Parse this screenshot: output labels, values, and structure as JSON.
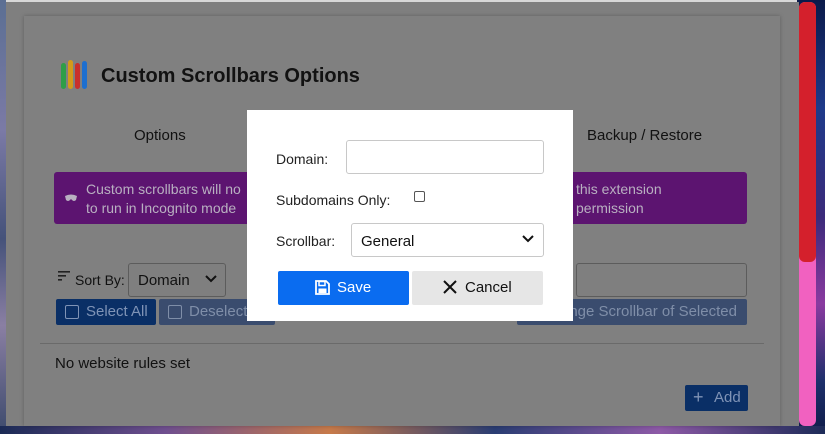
{
  "page": {
    "title": "Custom Scrollbars Options",
    "tabs": {
      "options": "Options",
      "backup": "Backup / Restore"
    },
    "notice": {
      "text_left": "Custom scrollbars will no",
      "text_right": "this extension permission",
      "text_left_2": "to run in Incognito mode",
      "icon": "incognito-mask-icon"
    },
    "sort": {
      "label": "Sort By:",
      "value": "Domain"
    },
    "buttons": {
      "select_all": "Select All",
      "deselect": "Deselect",
      "change_scrollbar": "ange Scrollbar of Selected",
      "add": "Add"
    },
    "empty_message": "No website rules set"
  },
  "modal": {
    "domain_label": "Domain:",
    "domain_value": "",
    "subdomains_label": "Subdomains Only:",
    "subdomains_checked": false,
    "scrollbar_label": "Scrollbar:",
    "scrollbar_value": "General",
    "save_label": "Save",
    "cancel_label": "Cancel"
  },
  "colors": {
    "accent": "#0a6cf0",
    "notice_bg": "#5c1470",
    "scroll_track": "#f161c0",
    "scroll_thumb": "#d4202c"
  }
}
